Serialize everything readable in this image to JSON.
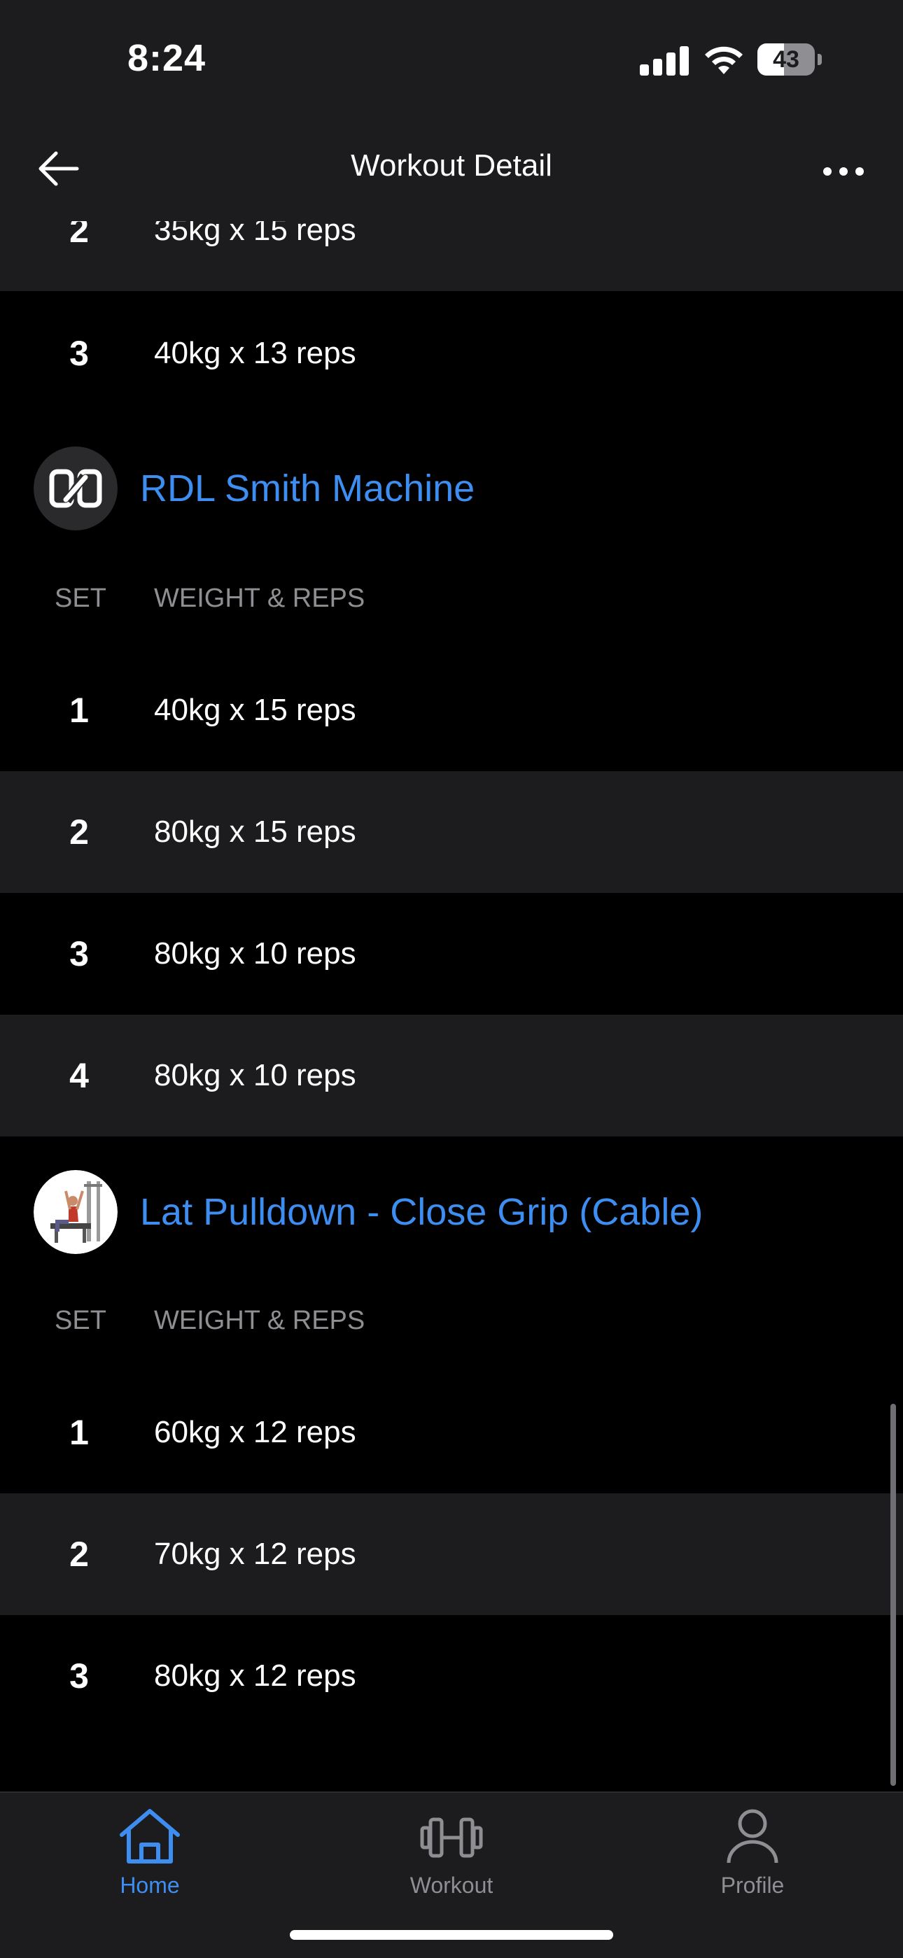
{
  "status_bar": {
    "time": "8:24",
    "battery": "43"
  },
  "header": {
    "title": "Workout Detail",
    "back_icon": "arrow-left-icon",
    "more_icon": "ellipsis-icon"
  },
  "previous_sets": [
    {
      "set": "2",
      "value": "35kg x 15 reps"
    },
    {
      "set": "3",
      "value": "40kg x 13 reps"
    }
  ],
  "exercises": [
    {
      "name": "RDL Smith Machine",
      "col_set": "SET",
      "col_weight": "WEIGHT & REPS",
      "sets": [
        {
          "set": "1",
          "value": "40kg x 15 reps"
        },
        {
          "set": "2",
          "value": "80kg x 15 reps"
        },
        {
          "set": "3",
          "value": "80kg x 10 reps"
        },
        {
          "set": "4",
          "value": "80kg x 10 reps"
        }
      ]
    },
    {
      "name": "Lat Pulldown - Close Grip (Cable)",
      "col_set": "SET",
      "col_weight": "WEIGHT & REPS",
      "sets": [
        {
          "set": "1",
          "value": "60kg x 12 reps"
        },
        {
          "set": "2",
          "value": "70kg x 12 reps"
        },
        {
          "set": "3",
          "value": "80kg x 12 reps"
        }
      ]
    }
  ],
  "tabs": [
    {
      "label": "Home",
      "icon": "home-icon",
      "active": true
    },
    {
      "label": "Workout",
      "icon": "dumbbell-icon",
      "active": false
    },
    {
      "label": "Profile",
      "icon": "person-icon",
      "active": false
    }
  ],
  "colors": {
    "accent": "#3d8ef0",
    "background": "#000000",
    "surface": "#1c1c1e",
    "muted": "#8e8e93"
  }
}
